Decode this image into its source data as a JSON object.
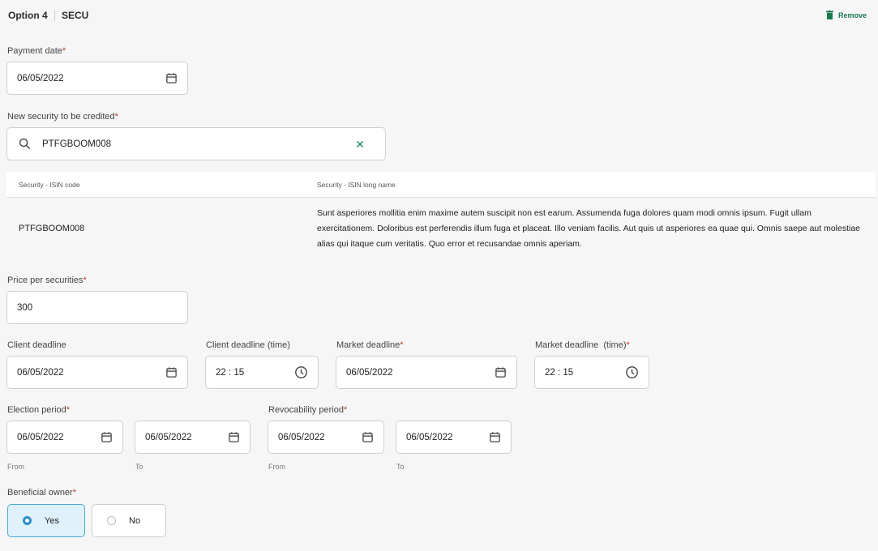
{
  "header": {
    "option_label": "Option 4",
    "option_type": "SECU",
    "remove_label": "Remove"
  },
  "payment_date": {
    "label": "Payment date",
    "value": "06/05/2022"
  },
  "new_security": {
    "label": "New security to be credited",
    "value": "PTFGBOOM008"
  },
  "security_table": {
    "columns": [
      "Security - ISIN code",
      "Security - ISIN long name"
    ],
    "rows": [
      {
        "isin": "PTFGBOOM008",
        "long_name": "Sunt asperiores mollitia enim maxime autem suscipit non est earum. Assumenda fuga dolores quam modi omnis ipsum. Fugit ullam exercitationem. Doloribus est perferendis illum fuga et placeat. Illo veniam facilis. Aut quis ut asperiores ea quae qui. Omnis saepe aut molestiae alias qui itaque cum veritatis. Quo error et recusandae omnis aperiam."
      }
    ]
  },
  "price": {
    "label": "Price per securities",
    "value": "300"
  },
  "client_deadline": {
    "label": "Client deadline",
    "value": "06/05/2022"
  },
  "client_deadline_time": {
    "label": "Client deadline (time)",
    "value": "22 : 15"
  },
  "market_deadline": {
    "label": "Market deadline",
    "value": "06/05/2022"
  },
  "market_deadline_time": {
    "label": "Market deadline  (time)",
    "value": "22 : 15"
  },
  "election_period": {
    "label": "Election period",
    "from_value": "06/05/2022",
    "to_value": "06/05/2022",
    "from_label": "From",
    "to_label": "To"
  },
  "revocability_period": {
    "label": "Revocability period",
    "from_value": "06/05/2022",
    "to_value": "06/05/2022",
    "from_label": "From",
    "to_label": "To"
  },
  "beneficial_owner": {
    "label": "Beneficial owner",
    "options": [
      "Yes",
      "No"
    ],
    "selected": "Yes"
  },
  "required_mark": "*",
  "icons": {
    "date": "calendar-icon",
    "time": "clock-icon",
    "search": "search-icon",
    "clear": "clear-icon",
    "remove": "trash-icon"
  }
}
